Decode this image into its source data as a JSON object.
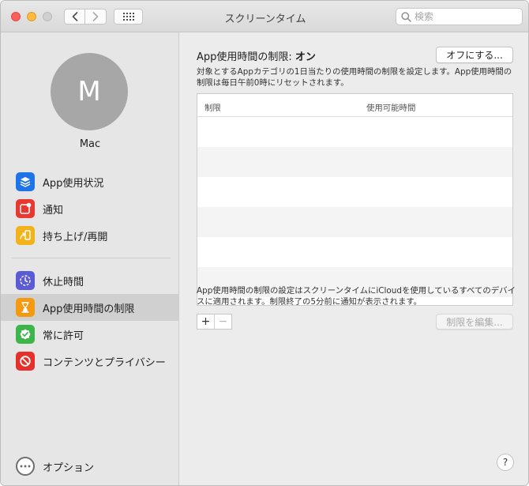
{
  "window": {
    "title": "スクリーンタイム"
  },
  "search": {
    "placeholder": "検索"
  },
  "user": {
    "initial": "M",
    "name": "Mac"
  },
  "sidebar": {
    "items": [
      {
        "label": "App使用状況",
        "icon": "layers-icon",
        "color": "#1f72e8"
      },
      {
        "label": "通知",
        "icon": "notification-icon",
        "color": "#e8382f"
      },
      {
        "label": "持ち上げ/再開",
        "icon": "pickup-icon",
        "color": "#f1b21a"
      },
      {
        "label": "休止時間",
        "icon": "downtime-icon",
        "color": "#5b5bd6"
      },
      {
        "label": "App使用時間の制限",
        "icon": "hourglass-icon",
        "color": "#f39a12",
        "selected": true
      },
      {
        "label": "常に許可",
        "icon": "checkmark-icon",
        "color": "#3cb64a"
      },
      {
        "label": "コンテンツとプライバシー",
        "icon": "restriction-icon",
        "color": "#e5302b"
      }
    ],
    "option_label": "オプション"
  },
  "main": {
    "heading_prefix": "App使用時間の制限: ",
    "heading_status": "オン",
    "off_button": "オフにする...",
    "description": "対象とするAppカテゴリの1日当たりの使用時間の制限を設定します。App使用時間の制限は毎日午前0時にリセットされます。",
    "table": {
      "columns": [
        "制限",
        "使用可能時間"
      ],
      "rows": []
    },
    "footer_description": "App使用時間の制限の設定はスクリーンタイムにiCloudを使用しているすべてのデバイスに適用されます。制限終了の5分前に通知が表示されます。",
    "add_label": "+",
    "remove_label": "−",
    "edit_button": "制限を編集...",
    "help_label": "?"
  }
}
